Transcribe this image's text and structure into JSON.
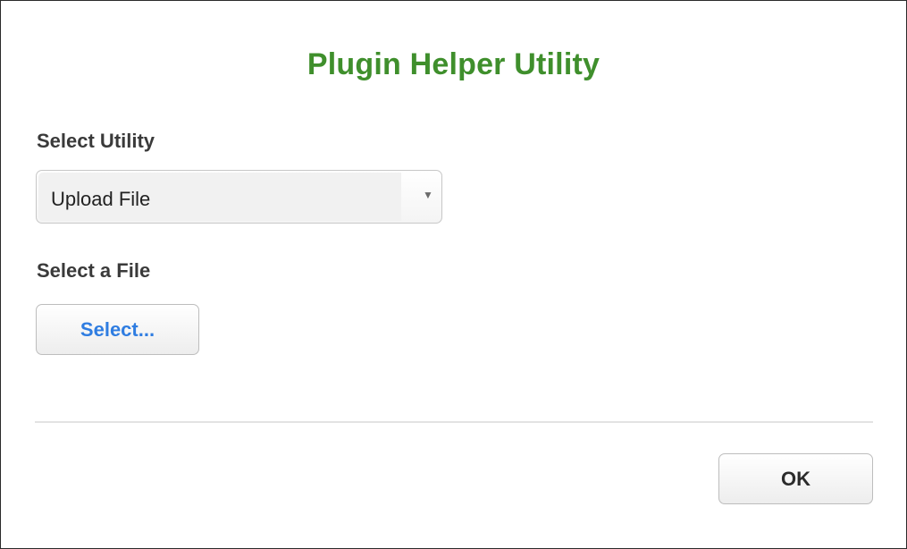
{
  "dialog": {
    "title": "Plugin Helper Utility",
    "utility": {
      "label": "Select Utility",
      "selected_value": "Upload File"
    },
    "file": {
      "label": "Select a File",
      "button_label": "Select..."
    },
    "footer": {
      "ok_label": "OK"
    }
  },
  "colors": {
    "title": "#3f8f2c",
    "select_button_text": "#2f7de1"
  },
  "icons": {
    "dropdown_arrow": "triangle-down"
  }
}
